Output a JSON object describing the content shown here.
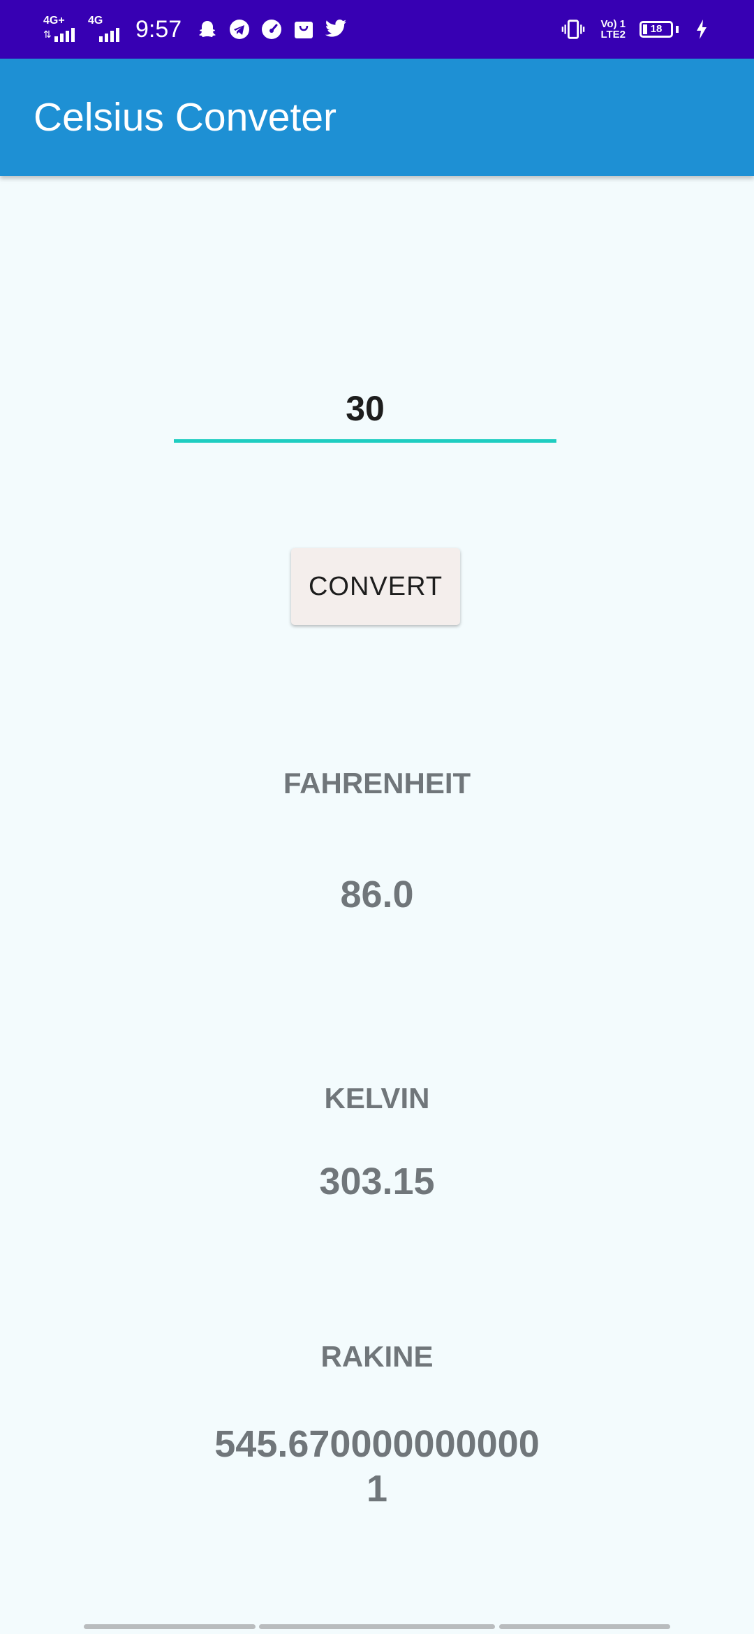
{
  "status_bar": {
    "network_1": "4G+",
    "network_2": "4G",
    "time": "9:57",
    "volte_line1": "Vo) 1",
    "volte_line2": "LTE2",
    "battery_level": "18",
    "app_icons": [
      "snapchat-icon",
      "telegram-icon",
      "speedometer-icon",
      "shopping-bag-icon",
      "twitter-icon"
    ]
  },
  "app_bar": {
    "title": "Celsius Conveter"
  },
  "form": {
    "celsius_value": "30",
    "convert_label": "CONVERT"
  },
  "results": {
    "fahrenheit_label": "FAHRENHEIT",
    "fahrenheit_value": "86.0",
    "kelvin_label": "KELVIN",
    "kelvin_value": "303.15",
    "rankine_label": "RAKINE",
    "rankine_value": "545.6700000000001"
  },
  "colors": {
    "status_bar": "#3700b3",
    "app_bar": "#1e90d4",
    "background": "#f3fbfd",
    "input_underline": "#1ecdc1",
    "button_bg": "#f4eeec",
    "result_text": "#70767a"
  }
}
